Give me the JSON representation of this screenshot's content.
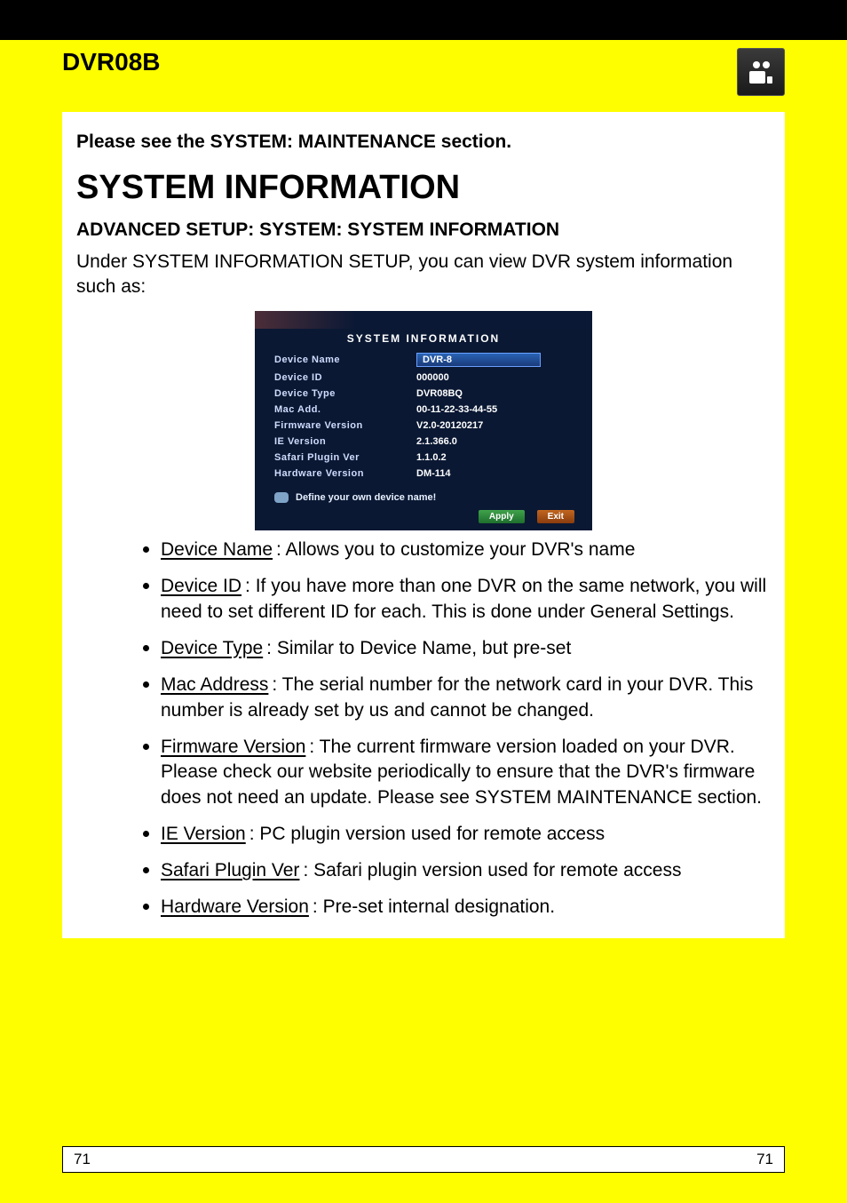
{
  "header": {
    "model": "DVR08B"
  },
  "intro": {
    "lead": "Please see the SYSTEM: MAINTENANCE section.",
    "h1": "SYSTEM INFORMATION",
    "h2": "ADVANCED SETUP:  SYSTEM:  SYSTEM INFORMATION",
    "para": "Under SYSTEM INFORMATION SETUP, you can view DVR system information such as:"
  },
  "screenshot": {
    "title": "SYSTEM INFORMATION",
    "rows": [
      {
        "label": "Device  Name",
        "value": "DVR-8",
        "input": true
      },
      {
        "label": "Device  ID",
        "value": "000000"
      },
      {
        "label": "Device  Type",
        "value": "DVR08BQ"
      },
      {
        "label": "Mac  Add.",
        "value": "00-11-22-33-44-55"
      },
      {
        "label": "Firmware  Version",
        "value": "V2.0-20120217"
      },
      {
        "label": "IE   Version",
        "value": "2.1.366.0"
      },
      {
        "label": "Safari  Plugin  Ver",
        "value": "1.1.0.2"
      },
      {
        "label": "Hardware  Version",
        "value": "DM-114"
      }
    ],
    "hint": "Define  your  own  device  name!",
    "apply": "Apply",
    "exit": "Exit"
  },
  "bullets": [
    {
      "term": "Device Name",
      "text": ": Allows you to customize your DVR's name"
    },
    {
      "term": "Device ID",
      "text": ": If you have more than one DVR on the same network, you will need to set different ID for each. This is done under General Settings."
    },
    {
      "term": "Device Type",
      "text": ": Similar to Device Name, but pre-set"
    },
    {
      "term": "Mac Address",
      "text": ": The serial number for the network card in your DVR. This number is already set by us and cannot be changed."
    },
    {
      "term": "Firmware Version",
      "text": ": The current firmware version loaded on your DVR. Please check our website periodically to ensure that the DVR's firmware does not need an update. Please see SYSTEM MAINTENANCE section."
    },
    {
      "term": "IE Version",
      "text": ": PC plugin version used for remote access"
    },
    {
      "term": "Safari Plugin Ver",
      "text": ": Safari plugin version used for remote access"
    },
    {
      "term": "Hardware Version",
      "text": ": Pre-set internal designation."
    }
  ],
  "footer": {
    "left": "71",
    "right": "71"
  }
}
